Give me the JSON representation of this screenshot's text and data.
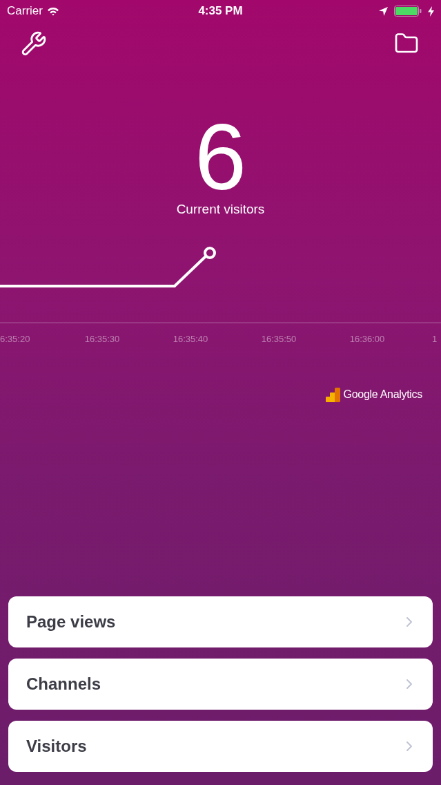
{
  "status_bar": {
    "carrier": "Carrier",
    "time": "4:35 PM"
  },
  "current": {
    "value": "6",
    "label": "Current visitors"
  },
  "chart": {
    "time_labels": [
      "6:35:20",
      "16:35:30",
      "16:35:40",
      "16:35:50",
      "16:36:00",
      "1"
    ]
  },
  "brand": {
    "name": "Google Analytics"
  },
  "menu": [
    {
      "label": "Page views"
    },
    {
      "label": "Channels"
    },
    {
      "label": "Visitors"
    }
  ]
}
